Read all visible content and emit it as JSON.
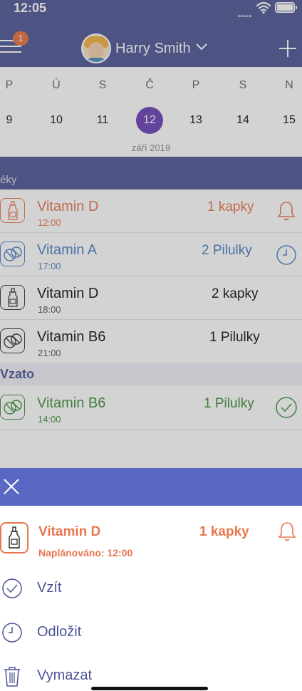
{
  "status_bar": {
    "time": "12:05"
  },
  "header": {
    "menu_badge": "1",
    "user_name": "Harry Smith"
  },
  "calendar": {
    "days": [
      {
        "name": "P",
        "date": "9"
      },
      {
        "name": "Ú",
        "date": "10"
      },
      {
        "name": "S",
        "date": "11"
      },
      {
        "name": "Č",
        "date": "12",
        "selected": true
      },
      {
        "name": "P",
        "date": "13"
      },
      {
        "name": "S",
        "date": "14"
      },
      {
        "name": "N",
        "date": "15"
      }
    ],
    "month": "září 2019"
  },
  "section": {
    "label": "éky"
  },
  "meds": [
    {
      "name": "Vitamin D",
      "time": "12:00",
      "dose": "1 kapky",
      "type": "drops",
      "color": "#e8764f",
      "status": "bell"
    },
    {
      "name": "Vitamin A",
      "time": "17:00",
      "dose": "2 Pilulky",
      "type": "pills",
      "color": "#4a7fc4",
      "status": "clock"
    },
    {
      "name": "Vitamin D",
      "time": "18:00",
      "dose": "2 kapky",
      "type": "drops",
      "color": "#111111",
      "status": "none"
    },
    {
      "name": "Vitamin B6",
      "time": "21:00",
      "dose": "1 Pilulky",
      "type": "pills",
      "color": "#111111",
      "status": "none"
    }
  ],
  "taken": {
    "label": "Vzato",
    "meds": [
      {
        "name": "Vitamin B6",
        "time": "14:00",
        "dose": "1 Pilulky",
        "type": "pills",
        "color": "#3e8e3a",
        "status": "check"
      }
    ]
  },
  "sheet": {
    "med_name": "Vitamin D",
    "med_dose": "1 kapky",
    "scheduled": "Naplánováno: 12:00",
    "actions": [
      {
        "label": "Vzít",
        "icon": "check-circle-icon"
      },
      {
        "label": "Odložit",
        "icon": "clock-icon"
      },
      {
        "label": "Vymazat",
        "icon": "trash-icon"
      }
    ]
  },
  "colors": {
    "primary": "#4c5495",
    "accent": "#e8764f",
    "selected": "#6a3fb5",
    "taken": "#3e8e3a",
    "sheet_header": "#5b68c3"
  }
}
